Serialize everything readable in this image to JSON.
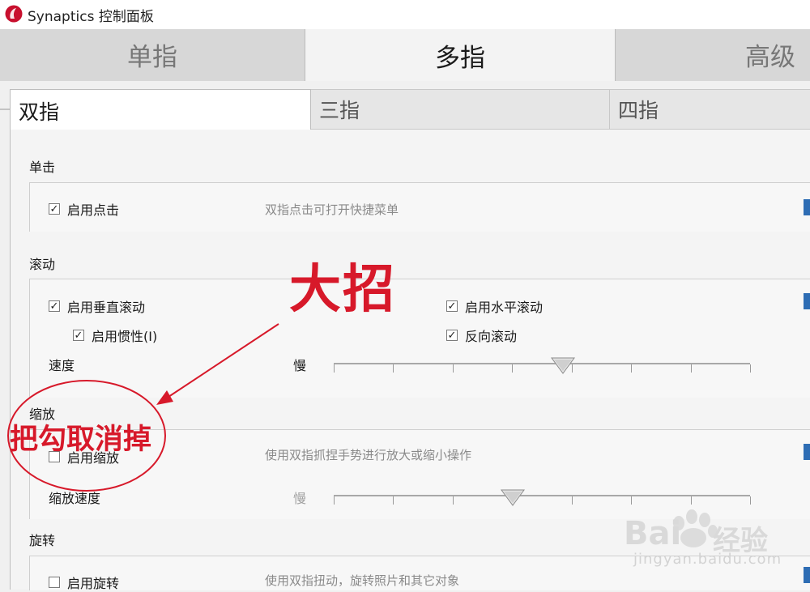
{
  "window": {
    "title": "Synaptics 控制面板",
    "logo_icon": "synaptics-logo-icon"
  },
  "main_tabs": [
    {
      "label": "单指",
      "selected": false
    },
    {
      "label": "多指",
      "selected": true
    },
    {
      "label": "高级",
      "selected": false
    }
  ],
  "sub_tabs": [
    {
      "label": "双指",
      "selected": true
    },
    {
      "label": "三指",
      "selected": false
    },
    {
      "label": "四指",
      "selected": false
    }
  ],
  "tap": {
    "title": "单击",
    "enable": {
      "label": "启用点击",
      "checked": true
    },
    "description": "双指点击可打开快捷菜单"
  },
  "scroll": {
    "title": "滚动",
    "vertical": {
      "label": "启用垂直滚动",
      "checked": true
    },
    "horizontal": {
      "label": "启用水平滚动",
      "checked": true
    },
    "inertia": {
      "label": "启用惯性(I)",
      "checked": true
    },
    "reverse": {
      "label": "反向滚动",
      "checked": true
    },
    "speed_label": "速度",
    "slow_label": "慢",
    "speed_level": 0.55
  },
  "zoom": {
    "title": "缩放",
    "enable": {
      "label": "启用缩放",
      "checked": false
    },
    "description": "使用双指抓捏手势进行放大或缩小操作",
    "speed_label": "缩放速度",
    "slow_label": "慢",
    "speed_level": 0.43
  },
  "rotate": {
    "title": "旋转",
    "enable": {
      "label": "启用旋转",
      "checked": false
    },
    "description": "使用双指扭动，旋转照片和其它对象"
  },
  "annotations": {
    "big_text": "大招",
    "small_text": "把勾取消掉",
    "color": "#d7192a"
  },
  "watermark": {
    "brand": "Bai",
    "brand_suffix": "经验",
    "url": "jingyan.baidu.com"
  },
  "colors": {
    "accent": "#2e6db4",
    "annotation": "#d7192a"
  }
}
